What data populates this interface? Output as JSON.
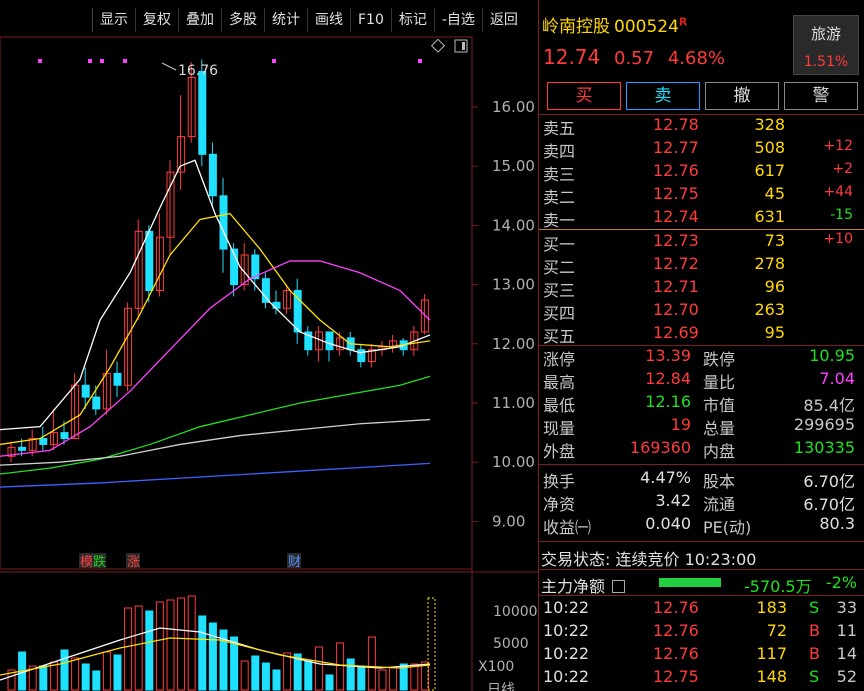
{
  "toolbar": [
    "显示",
    "复权",
    "叠加",
    "多股",
    "统计",
    "画线",
    "F10",
    "标记",
    "-自选",
    "返回"
  ],
  "chart": {
    "yticks": [
      "16.00",
      "15.00",
      "14.00",
      "13.00",
      "12.00",
      "11.00",
      "10.00",
      "9.00"
    ],
    "vol_ticks": [
      "10000",
      "5000",
      "X100"
    ],
    "peak_label": "16.76",
    "events": [
      {
        "text": "模",
        "color": "#ff4040"
      },
      {
        "text": "跌",
        "color": "#20d020"
      },
      {
        "text": "涨",
        "color": "#ff4040"
      },
      {
        "text": "财",
        "color": "#5090ff"
      }
    ],
    "bottom_label": "日线",
    "colors": {
      "up": "#ff3b3b",
      "down": "#20e0ff",
      "ma5": "#ffffff",
      "ma10": "#ffe000",
      "ma20": "#ff40ff",
      "ma60": "#20e020",
      "ma120": "#d0d0d0",
      "ma250": "#4060ff"
    }
  },
  "stock": {
    "name": "岭南控股",
    "code": "000524",
    "badge": "R",
    "price": "12.74",
    "change": "0.57",
    "pct": "4.68%"
  },
  "sector": {
    "name": "旅游",
    "pct": "1.51%"
  },
  "trade_buttons": [
    "买",
    "卖",
    "撤",
    "警"
  ],
  "asks": [
    {
      "label": "卖五",
      "price": "12.78",
      "vol": "328",
      "chg": ""
    },
    {
      "label": "卖四",
      "price": "12.77",
      "vol": "508",
      "chg": "+12"
    },
    {
      "label": "卖三",
      "price": "12.76",
      "vol": "617",
      "chg": "+2"
    },
    {
      "label": "卖二",
      "price": "12.75",
      "vol": "45",
      "chg": "+44"
    },
    {
      "label": "卖一",
      "price": "12.74",
      "vol": "631",
      "chg": "-15"
    }
  ],
  "bids": [
    {
      "label": "买一",
      "price": "12.73",
      "vol": "73",
      "chg": "+10"
    },
    {
      "label": "买二",
      "price": "12.72",
      "vol": "278",
      "chg": ""
    },
    {
      "label": "买三",
      "price": "12.71",
      "vol": "96",
      "chg": ""
    },
    {
      "label": "买四",
      "price": "12.70",
      "vol": "263",
      "chg": ""
    },
    {
      "label": "买五",
      "price": "12.69",
      "vol": "95",
      "chg": ""
    }
  ],
  "stats1": [
    {
      "l1": "涨停",
      "v1": "13.39",
      "c1": "#ff3b3b",
      "l2": "跌停",
      "v2": "10.95",
      "c2": "#20e020"
    },
    {
      "l1": "最高",
      "v1": "12.84",
      "c1": "#ff3b3b",
      "l2": "量比",
      "v2": "7.04",
      "c2": "#ff40ff"
    },
    {
      "l1": "最低",
      "v1": "12.16",
      "c1": "#20e020",
      "l2": "市值",
      "v2": "85.4亿",
      "c2": "#c8c8c8"
    },
    {
      "l1": "现量",
      "v1": "19",
      "c1": "#ff3b3b",
      "l2": "总量",
      "v2": "299695",
      "c2": "#c8c8c8"
    },
    {
      "l1": "外盘",
      "v1": "169360",
      "c1": "#ff3b3b",
      "l2": "内盘",
      "v2": "130335",
      "c2": "#20e020"
    }
  ],
  "stats2": [
    {
      "l1": "换手",
      "v1": "4.47%",
      "l2": "股本",
      "v2": "6.70亿"
    },
    {
      "l1": "净资",
      "v1": "3.42",
      "l2": "流通",
      "v2": "6.70亿"
    },
    {
      "l1": "收益㈠",
      "v1": "0.040",
      "l2": "PE(动)",
      "v2": "80.3"
    }
  ],
  "trade_status": "交易状态: 连续竞价 10:23:00",
  "main_flow": {
    "label": "主力净额",
    "value": "-570.5万",
    "pct": "-2%"
  },
  "ticks": [
    {
      "time": "10:22",
      "price": "12.76",
      "vol": "183",
      "side": "S",
      "n": "33"
    },
    {
      "time": "10:22",
      "price": "12.76",
      "vol": "72",
      "side": "B",
      "n": "11"
    },
    {
      "time": "10:22",
      "price": "12.76",
      "vol": "117",
      "side": "B",
      "n": "14"
    },
    {
      "time": "10:22",
      "price": "12.75",
      "vol": "148",
      "side": "S",
      "n": "52"
    }
  ]
}
